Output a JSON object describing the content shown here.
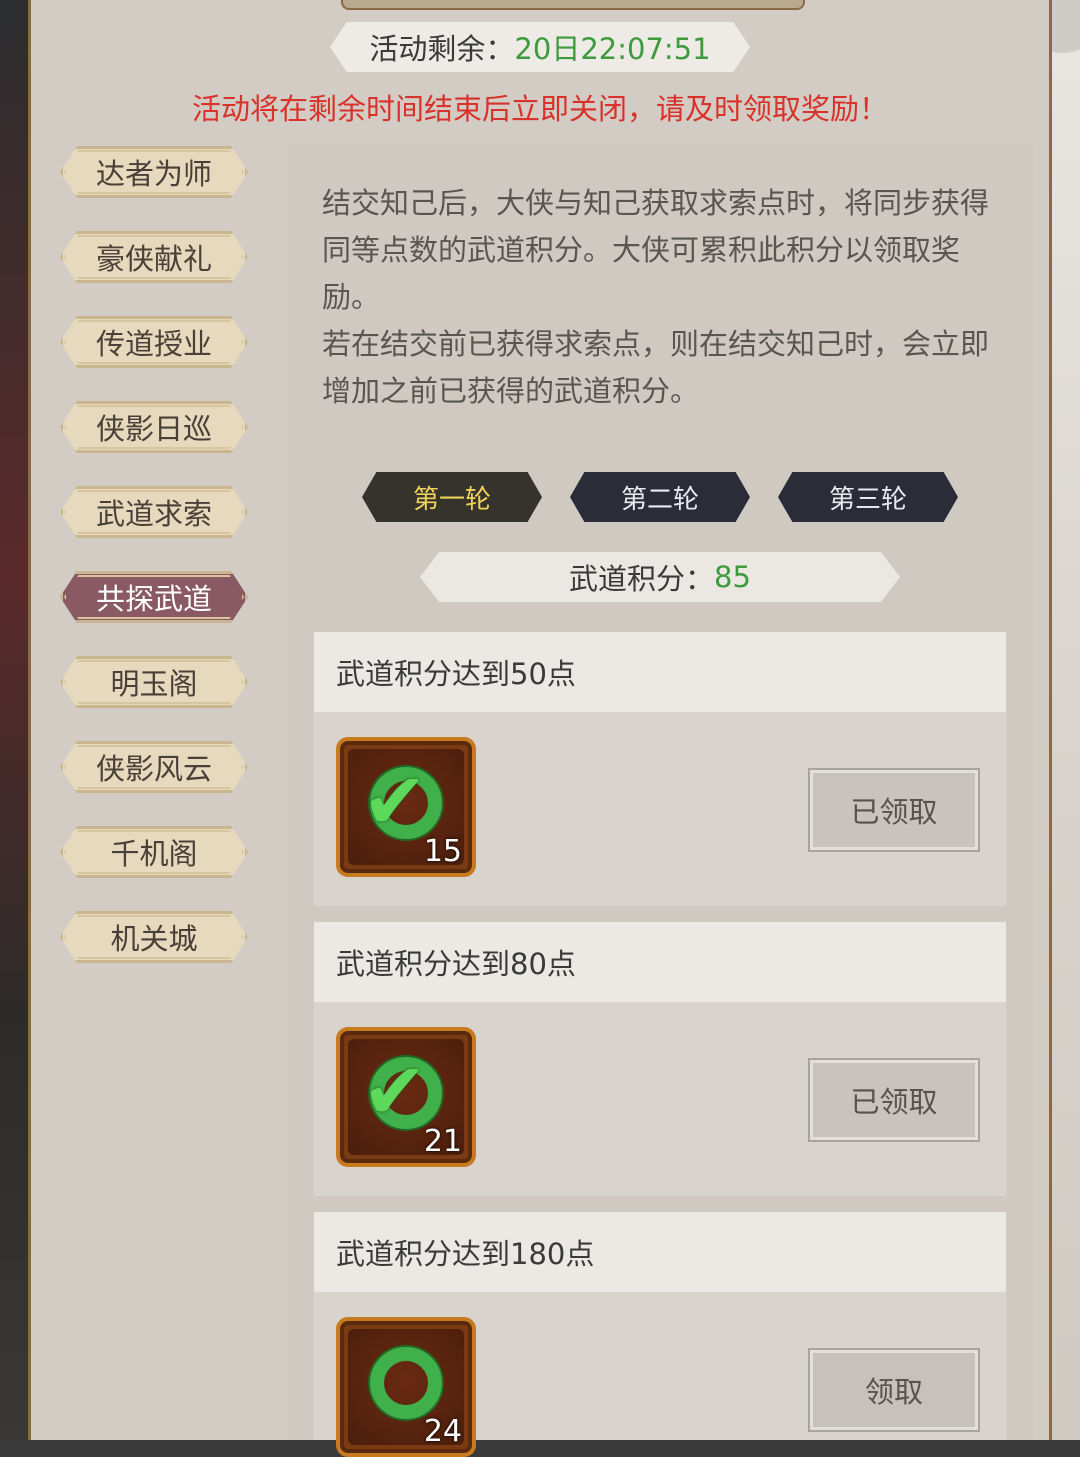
{
  "header": {
    "timer_label": "活动剩余：",
    "timer_value": "20日22:07:51",
    "notice": "活动将在剩余时间结束后立即关闭，请及时领取奖励！"
  },
  "sidebar": {
    "items": [
      {
        "label": "达者为师"
      },
      {
        "label": "豪侠献礼"
      },
      {
        "label": "传道授业"
      },
      {
        "label": "侠影日巡"
      },
      {
        "label": "武道求索"
      },
      {
        "label": "共探武道"
      },
      {
        "label": "明玉阁"
      },
      {
        "label": "侠影风云"
      },
      {
        "label": "千机阁"
      },
      {
        "label": "机关城"
      }
    ],
    "active": "共探武道"
  },
  "description": {
    "p1": "结交知己后，大侠与知己获取求索点时，将同步获得同等点数的武道积分。大侠可累积此积分以领取奖励。",
    "p2": "若在结交前已获得求索点，则在结交知己时，会立即增加之前已获得的武道积分。"
  },
  "rounds": {
    "tabs": [
      {
        "label": "第一轮"
      },
      {
        "label": "第二轮"
      },
      {
        "label": "第三轮"
      }
    ],
    "active": "第一轮"
  },
  "points": {
    "label": "武道积分：",
    "value": "85"
  },
  "rewards": [
    {
      "title": "武道积分达到50点",
      "qty": "15",
      "button": "已领取",
      "claimed": true
    },
    {
      "title": "武道积分达到80点",
      "qty": "21",
      "button": "已领取",
      "claimed": true
    },
    {
      "title": "武道积分达到180点",
      "qty": "24",
      "button": "领取",
      "claimed": false
    }
  ],
  "colors": {
    "accent_green": "#3d9a3d",
    "warning_red": "#d8322a",
    "active_tab": "#8a5a64",
    "round_active_text": "#f0d25a"
  },
  "icons": {
    "reward_item": "jade-disc-icon",
    "claimed_mark": "check-icon"
  }
}
